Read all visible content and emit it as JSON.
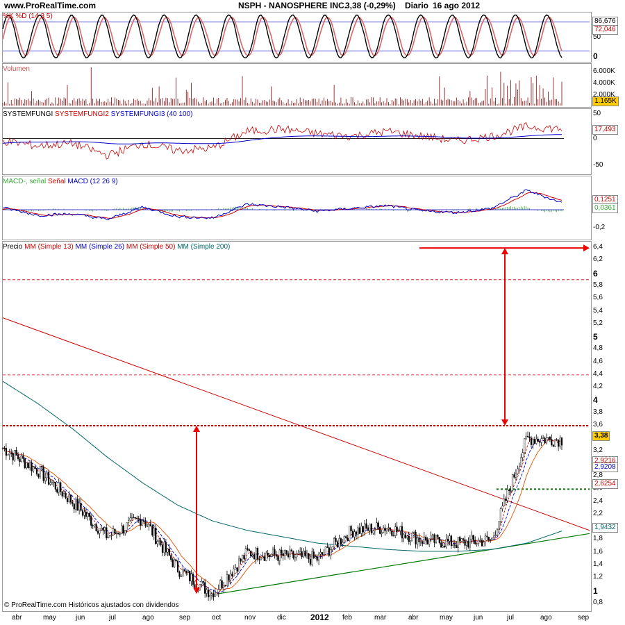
{
  "header": {
    "site": "www.ProRealTime.com",
    "title": "NSPH - NANOSPHERE INC.",
    "quote": "3,38 (-0,29%)",
    "period": "Diario",
    "date": "16 ago 2012"
  },
  "footer": "© ProRealTime.com  Históricos ajustados con dividendos",
  "colors": {
    "red": "#cc0000",
    "blue": "#0000cc",
    "teal": "#006666",
    "green": "#007700",
    "orange": "#e05000",
    "arrow": "#ee0000"
  },
  "chart_data": [
    {
      "type": "line",
      "panel": "stochastic",
      "title": "%K %D (14 3 5)",
      "y_ticks": [
        "50",
        "0"
      ],
      "ylim": [
        0,
        100
      ],
      "series": [
        {
          "name": "%K",
          "values_badge": "86,676"
        },
        {
          "name": "%D",
          "values_badge": "72,046"
        }
      ],
      "ref_lines": [
        80,
        20
      ]
    },
    {
      "type": "bar",
      "panel": "volume",
      "title": "Volumen",
      "y_ticks": [
        "6.000K",
        "4.000K",
        "2.000K"
      ],
      "last_badge": "1.165K"
    },
    {
      "type": "line",
      "panel": "systemfungi",
      "title_parts": [
        "SYSTEMFUNGI",
        "SYSTEMFUNGI2",
        "SYSTEMFUNGI3 (40 100)"
      ],
      "y_ticks": [
        "50",
        "0",
        "-50"
      ],
      "last_badge": "17,493"
    },
    {
      "type": "area",
      "panel": "macd",
      "title_parts": [
        "MACD-, señal",
        "Señal",
        "MACD (12 26 9)"
      ],
      "y_ticks": [
        "-0,2"
      ],
      "badges": [
        "0,1251",
        "0,0361"
      ]
    },
    {
      "type": "line",
      "panel": "price",
      "title_parts": [
        "Precio",
        "MM (Simple 13)",
        "MM (Simple 26)",
        "MM (Simple 50)",
        "MM (Simple 200)"
      ],
      "y_ticks": [
        "6,4",
        "6,2",
        "6",
        "5,8",
        "5,6",
        "5,4",
        "5,2",
        "5",
        "4,8",
        "4,6",
        "4,4",
        "4,2",
        "4",
        "3,8",
        "3,6",
        "3,4",
        "3,2",
        "3",
        "2,8",
        "2,6",
        "2,4",
        "2,2",
        "2",
        "1,8",
        "1,6",
        "1,4",
        "1,2",
        "1",
        "0,8"
      ],
      "ylim": [
        0.7,
        6.5
      ],
      "badges": {
        "last": "3,38",
        "ma13": "2,9208",
        "ma26": "2,9216",
        "ma50": "2,6254",
        "ma200": "1,9432"
      },
      "close_series": {
        "x": [
          "abr",
          "may",
          "jun",
          "jul",
          "ago",
          "sep",
          "oct",
          "nov",
          "dic",
          "2012",
          "feb",
          "mar",
          "abr",
          "may",
          "jun",
          "jul",
          "ago"
        ],
        "values": [
          3.25,
          2.9,
          2.4,
          1.85,
          2.15,
          1.35,
          0.95,
          1.6,
          1.55,
          1.5,
          1.95,
          2.0,
          1.8,
          1.75,
          1.8,
          3.4,
          3.38
        ]
      },
      "ma200_values": [
        4.3,
        3.95,
        3.55,
        3.1,
        2.7,
        2.35,
        2.1,
        1.95,
        1.85,
        1.75,
        1.7,
        1.65,
        1.62,
        1.62,
        1.65,
        1.75,
        1.94
      ],
      "resistance": 3.6,
      "target": 6.4,
      "support_dotted": 2.6,
      "dashed_levels": [
        5.9,
        4.4
      ],
      "diagonal_down": {
        "from": 5.3,
        "to": 1.95
      },
      "trend_up": {
        "from": 0.95,
        "to": 1.9
      }
    }
  ],
  "x_axis": [
    "abr",
    "may",
    "jun",
    "jul",
    "ago",
    "sep",
    "oct",
    "nov",
    "dic",
    "2012",
    "feb",
    "mar",
    "abr",
    "may",
    "jun",
    "jul",
    "ago",
    "sep"
  ]
}
